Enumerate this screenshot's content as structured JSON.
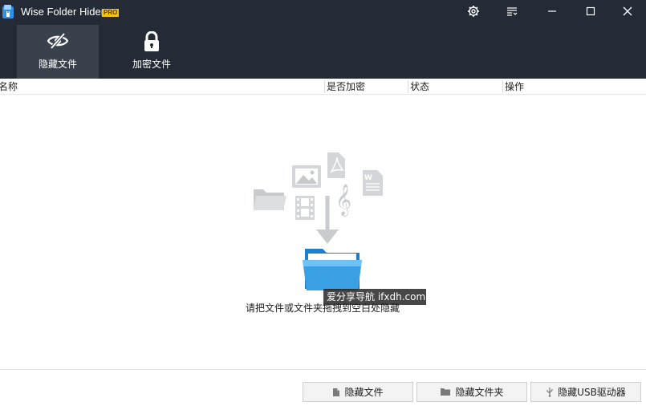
{
  "window": {
    "title": "Wise Folder Hider",
    "badge": "PRO"
  },
  "nav": {
    "tabs": [
      {
        "label": "隐藏文件",
        "icon": "eye-slash-icon",
        "active": true
      },
      {
        "label": "加密文件",
        "icon": "lock-icon",
        "active": false
      }
    ]
  },
  "table": {
    "columns": [
      "名称",
      "是否加密",
      "状态",
      "操作"
    ]
  },
  "empty_state": {
    "hint": "请把文件或文件夹拖拽到空白处隐藏",
    "watermark": "爱分享导航 ifxdh.com"
  },
  "actions": {
    "hide_file": "隐藏文件",
    "hide_folder": "隐藏文件夹",
    "hide_usb": "隐藏USB驱动器"
  },
  "colors": {
    "header_bg": "#252b36",
    "active_tab_bg": "#3a414d",
    "badge": "#f6c21a",
    "folder_blue": "#3aa0e4"
  }
}
